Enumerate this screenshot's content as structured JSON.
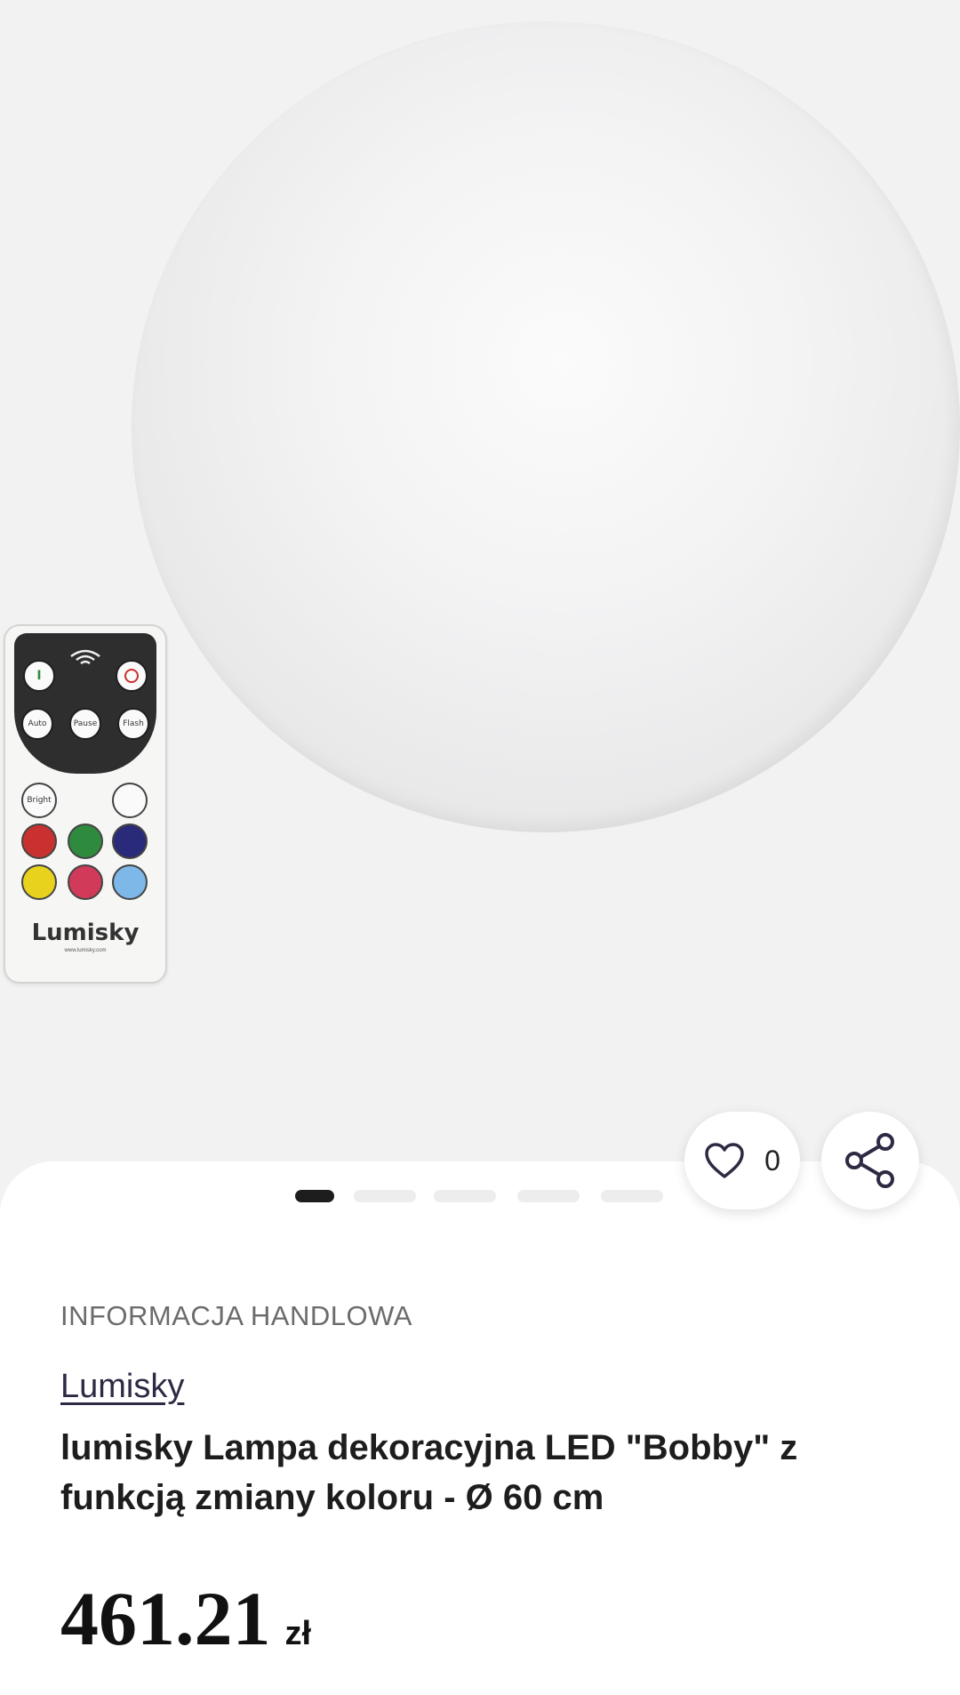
{
  "product": {
    "info_label": "INFORMACJA HANDLOWA",
    "brand": "Lumisky",
    "title": "lumisky Lampa dekoracyjna LED \"Bobby\" z funkcją zmiany koloru - Ø 60 cm",
    "price_amount": "461.21",
    "price_currency": "zł"
  },
  "favorites": {
    "count": "0",
    "icon": "heart-icon"
  },
  "share": {
    "icon": "share-icon"
  },
  "gallery": {
    "total_images": 5,
    "active_index": 0
  },
  "remote": {
    "brand": "Lumisky",
    "url": "www.lumisky.com",
    "buttons": {
      "on": "I",
      "auto": "Auto",
      "pause": "Pause",
      "flash": "Flash",
      "bright": "Bright"
    },
    "color_buttons": [
      "#c8312f",
      "#2e8b3e",
      "#2a2a7a",
      "#e8d21e",
      "#d23a5a",
      "#7db8e8"
    ]
  }
}
